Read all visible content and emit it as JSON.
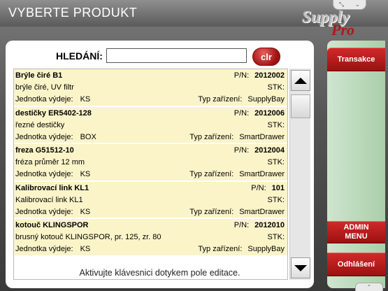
{
  "header": {
    "title": "VYBERTE PRODUKT"
  },
  "logo": {
    "line1": "Supply",
    "line2": "Pro"
  },
  "search": {
    "label": "HLEDÁNÍ:",
    "value": "",
    "clear_label": "clr"
  },
  "products": [
    {
      "name": "Brýle čiré B1",
      "pn_label": "P/N:",
      "pn": "2012002",
      "desc": "brýle čiré, UV filtr",
      "stk_label": "STK:",
      "unit_label": "Jednotka výdeje:",
      "unit": "KS",
      "device_label": "Typ zařízení:",
      "device": "SupplyBay"
    },
    {
      "name": "destičky ER5402-128",
      "pn_label": "P/N:",
      "pn": "2012006",
      "desc": "řezné destičky",
      "stk_label": "STK:",
      "unit_label": "Jednotka výdeje:",
      "unit": "BOX",
      "device_label": "Typ zařízení:",
      "device": "SmartDrawer"
    },
    {
      "name": "freza G51512-10",
      "pn_label": "P/N:",
      "pn": "2012004",
      "desc": "fréza průměr 12 mm",
      "stk_label": "STK:",
      "unit_label": "Jednotka výdeje:",
      "unit": "KS",
      "device_label": "Typ zařízení:",
      "device": "SmartDrawer"
    },
    {
      "name": "Kalibrovací link KL1",
      "pn_label": "P/N:",
      "pn": "101",
      "desc": "Kalibrovací link KL1",
      "stk_label": "STK:",
      "unit_label": "Jednotka výdeje:",
      "unit": "KS",
      "device_label": "Typ zařízení:",
      "device": "SmartDrawer"
    },
    {
      "name": "kotouč KLINGSPOR",
      "pn_label": "P/N:",
      "pn": "2012010",
      "desc": "brusný kotouč KLINGSPOR, pr. 125, zr. 80",
      "stk_label": "STK:",
      "unit_label": "Jednotka výdeje:",
      "unit": "KS",
      "device_label": "Typ zařízení:",
      "device": "SupplyBay"
    }
  ],
  "hint": "Aktivujte klávesnici dotykem pole editace.",
  "sidebar": {
    "transakce": "Transakce",
    "admin_line1": "ADMIN",
    "admin_line2": "MENU",
    "logout": "Odhlášení"
  }
}
